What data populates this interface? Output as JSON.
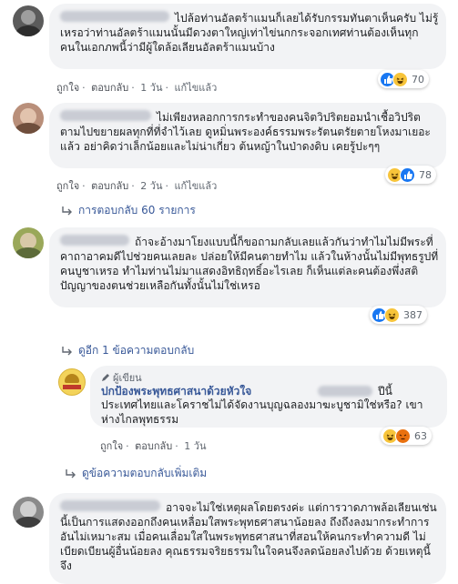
{
  "comments": [
    {
      "text": "ไปล้อท่านอัลตร้าแมนก็เลยได้รับกรรมทันตาเห็นครับ ไม่รู้เหรอว่าท่านอัลตร้าแมนนั้นมีดวงตาใหญ่เท่าไข่นกกระจอกเทศท่านต้องเห็นทุกคนในเอกภพนี้ว่ามีผู้ใดล้อเลียนอัลตร้าแมนบ้าง",
      "like": "ถูกใจ",
      "reply": "ตอบกลับ",
      "time": "1 วัน",
      "edited": "แก้ไขแล้ว",
      "reaction_count": "70"
    },
    {
      "text": "ไม่เพียงหลอกการกระทำของคนจิตวิปริตยอมนำเชื้อวิปริตตามไปขยายผลทุกที่ที่จำไว้เลย ดูหมิ่นพระองค์ธรรมพระรัตนตรัยตายโหงมาเยอะแล้ว อย่าคิดว่าเล็กน้อยและไม่น่าเกี่ยว ต้นหญ้าในป่าดงดิบ เคยรู้ปะๆๆ",
      "like": "ถูกใจ",
      "reply": "ตอบกลับ",
      "time": "2 วัน",
      "edited": "แก้ไขแล้ว",
      "reaction_count": "78",
      "replies_link": "การตอบกลับ 60 รายการ"
    },
    {
      "text": "ถ้าจะอ้างมาโยงแบบนี้ก็ขอถามกลับเลยแล้วกันว่าทำไมไม่มีพระที่คาถาอาคมดีไปช่วยคนเลยละ ปล่อยให้มีคนตายทำไม แล้วในห้างนั้นไม่มีพุทธรูปที่คนบูชาเหรอ ทำไมท่านไม่มาแสดงอิทธิฤทธิ์อะไรเลย ก็เห็นแต่ละคนต้องพึ่งสติปัญญาของตนช่วยเหลือกันทั้งนั้นไม่ใช่เหรอ",
      "reaction_count": "387",
      "more_replies": "ดูอีก 1 ข้อความตอบกลับ"
    }
  ],
  "reply": {
    "badge": "ผู้เขียน",
    "page_name": "ปกป้องพระพุทธศาสนาด้วยหัวใจ",
    "text_tail": "ปีนี้",
    "text": "ประเทศไทยและโคราชไม่ได้จัดงานบุญฉลองมาฆะบูชามิใช่หรือ? เขาห่างไกลพุทธรรม",
    "like": "ถูกใจ",
    "reply": "ตอบกลับ",
    "time": "1 วัน",
    "reaction_count": "63",
    "more_replies": "ดูข้อความตอบกลับเพิ่มเติม"
  },
  "last_comment": {
    "text": "อาจจะไม่ใช่เหตุผลโดยตรงค่ะ แต่การวาดภาพล้อเลียนเช่นนี้เป็นการแสดงออกถึงคนเหลื่อมใสพระพุทธศาสนาน้อยลง ถึงถึงลงมากระทำการอันไม่เหมาะสม เมื่อคนเลื่อมใสในพระพุทธศาสนาที่สอนให้คนกระทำความดี ไม่เบียดเบียนผู้อื่นน้อยลง คุณธรรมจริยธรรมในใจคนจึงลดน้อยลงไปด้วย ด้วยเหตุนี้จึง"
  },
  "colors": {
    "bubble": "#f2f3f5",
    "link": "#385898",
    "meta": "#606770",
    "like": "#1877f2",
    "haha": "#f7c43a",
    "angry": "#e9710f"
  },
  "icons": [
    "reply-arrow-icon",
    "pencil-icon",
    "like-reaction-icon",
    "haha-reaction-icon",
    "angry-reaction-icon"
  ]
}
